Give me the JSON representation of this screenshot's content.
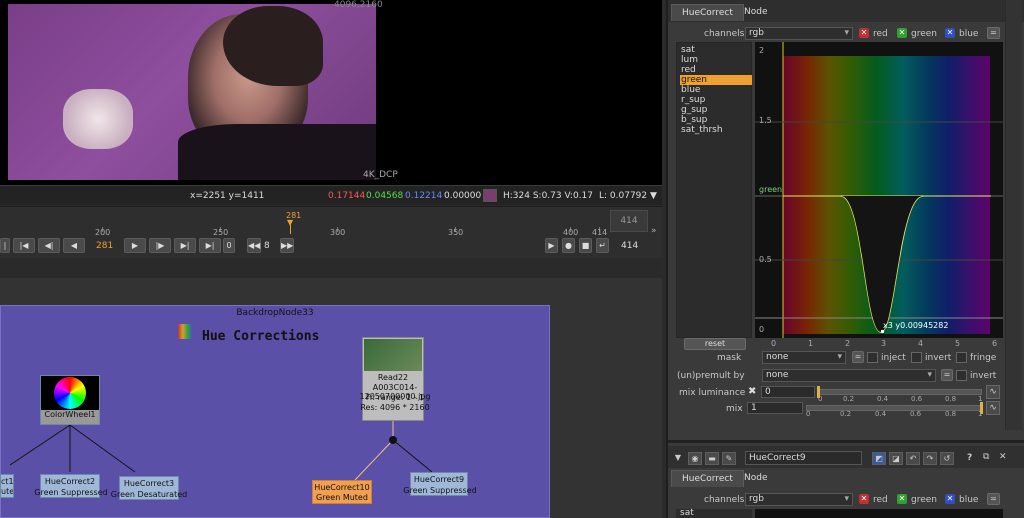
{
  "viewer": {
    "resolution": "4096,2160",
    "format": "4K_DCP",
    "coords": "x=2251 y=1411",
    "r": "0.17144",
    "g": "0.04568",
    "b": "0.12214",
    "a": "0.00000",
    "hsv": "H:324 S:0.73 V:0.17",
    "lum": "L: 0.07792"
  },
  "timeline": {
    "current": "281",
    "ticks": [
      "200",
      "250",
      "300",
      "350",
      "400",
      "414"
    ],
    "end_frame": "414",
    "current_display": "281",
    "zero": "0",
    "step": "8",
    "out_frame": "414"
  },
  "nodegraph": {
    "backdrop_title": "BackdropNode33",
    "backdrop_label": "Hue Corrections",
    "read_node": {
      "name": "Read22",
      "file": "A003C014-12050700000.jpg",
      "range": "Fr. range: 1 - 1",
      "res": "Res: 4096 * 2160"
    },
    "colorwheel": "ColorWheel1",
    "nodes": [
      {
        "name": "HueCorrect2",
        "sub": "Green Suppressed"
      },
      {
        "name": "HueCorrect3",
        "sub": "Green Desaturated"
      },
      {
        "name": "HueCorrect10",
        "sub": "Green Muted"
      },
      {
        "name": "HueCorrect9",
        "sub": "Green Suppressed"
      }
    ],
    "left_partial": {
      "name": "ct1",
      "sub": "uted"
    }
  },
  "panel": {
    "tabs": [
      "HueCorrect",
      "Node"
    ],
    "channels_label": "channels",
    "channels_value": "rgb",
    "red": "red",
    "green": "green",
    "blue": "blue",
    "eq": "=",
    "curves": [
      "sat",
      "lum",
      "red",
      "green",
      "blue",
      "r_sup",
      "g_sup",
      "b_sup",
      "sat_thrsh"
    ],
    "selected_curve": "green",
    "reset": "reset",
    "graph_y": [
      "2",
      "1.5",
      "0.5",
      "0"
    ],
    "graph_x": [
      "0",
      "1",
      "2",
      "3",
      "4",
      "5",
      "6"
    ],
    "curve_label": "green",
    "point_readout": "x3 y0.00945282",
    "mask_label": "mask",
    "mask_value": "none",
    "inject": "inject",
    "invert": "invert",
    "fringe": "fringe",
    "premult_label": "(un)premult by",
    "premult_value": "none",
    "invert2": "invert",
    "mixlum_label": "mix luminance",
    "mixlum_value": "0",
    "mix_label": "mix",
    "mix_value": "1",
    "slider_ticks": [
      "0",
      "0.2",
      "0.4",
      "0.6",
      "0.8",
      "1"
    ]
  },
  "panel2": {
    "node_name": "HueCorrect9",
    "tabs": [
      "HueCorrect",
      "Node"
    ],
    "channels_label": "channels",
    "channels_value": "rgb",
    "red": "red",
    "green": "green",
    "blue": "blue",
    "first_curve": "sat",
    "help": "?"
  }
}
